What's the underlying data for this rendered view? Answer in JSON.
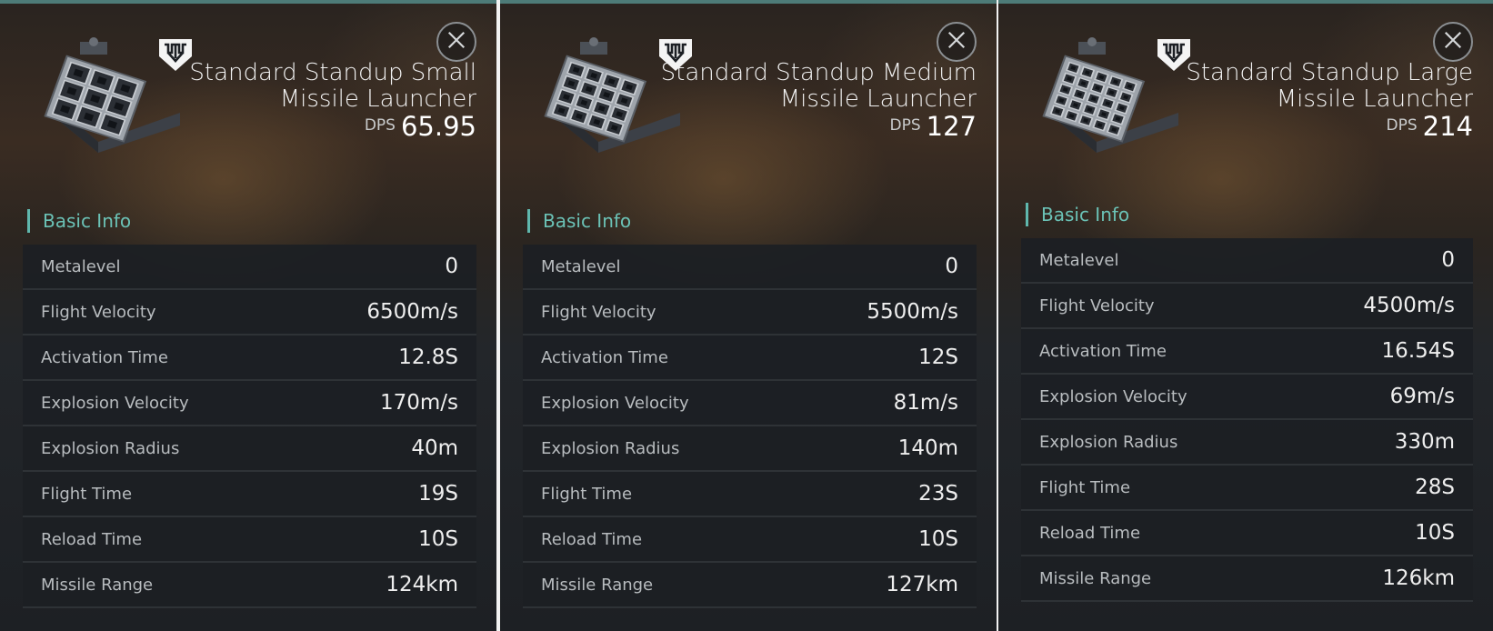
{
  "panels": [
    {
      "title": "Standard Standup Small Missile Launcher",
      "dps_label": "DPS",
      "dps_value": "65.95",
      "section": "Basic Info",
      "grid": 3,
      "stats": [
        {
          "label": "Metalevel",
          "value": "0"
        },
        {
          "label": "Flight Velocity",
          "value": "6500m/s"
        },
        {
          "label": "Activation Time",
          "value": "12.8S"
        },
        {
          "label": "Explosion Velocity",
          "value": "170m/s"
        },
        {
          "label": "Explosion Radius",
          "value": "40m"
        },
        {
          "label": "Flight Time",
          "value": "19S"
        },
        {
          "label": "Reload Time",
          "value": "10S"
        },
        {
          "label": "Missile Range",
          "value": "124km"
        }
      ]
    },
    {
      "title": "Standard Standup Medium Missile Launcher",
      "dps_label": "DPS",
      "dps_value": "127",
      "section": "Basic Info",
      "grid": 4,
      "stats": [
        {
          "label": "Metalevel",
          "value": "0"
        },
        {
          "label": "Flight Velocity",
          "value": "5500m/s"
        },
        {
          "label": "Activation Time",
          "value": "12S"
        },
        {
          "label": "Explosion Velocity",
          "value": "81m/s"
        },
        {
          "label": "Explosion Radius",
          "value": "140m"
        },
        {
          "label": "Flight Time",
          "value": "23S"
        },
        {
          "label": "Reload Time",
          "value": "10S"
        },
        {
          "label": "Missile Range",
          "value": "127km"
        }
      ]
    },
    {
      "title": "Standard Standup Large Missile Launcher",
      "dps_label": "DPS",
      "dps_value": "214",
      "section": "Basic Info",
      "grid": 5,
      "stats": [
        {
          "label": "Metalevel",
          "value": "0"
        },
        {
          "label": "Flight Velocity",
          "value": "4500m/s"
        },
        {
          "label": "Activation Time",
          "value": "16.54S"
        },
        {
          "label": "Explosion Velocity",
          "value": "69m/s"
        },
        {
          "label": "Explosion Radius",
          "value": "330m"
        },
        {
          "label": "Flight Time",
          "value": "28S"
        },
        {
          "label": "Reload Time",
          "value": "10S"
        },
        {
          "label": "Missile Range",
          "value": "126km"
        }
      ]
    }
  ],
  "icons": {
    "close": "close-icon",
    "badge": "faction-shield-icon",
    "item": "missile-launcher-icon"
  },
  "colors": {
    "accent": "#6bc2b6",
    "row_bg": "#1c1f23",
    "border_top": "#4d7b78"
  }
}
